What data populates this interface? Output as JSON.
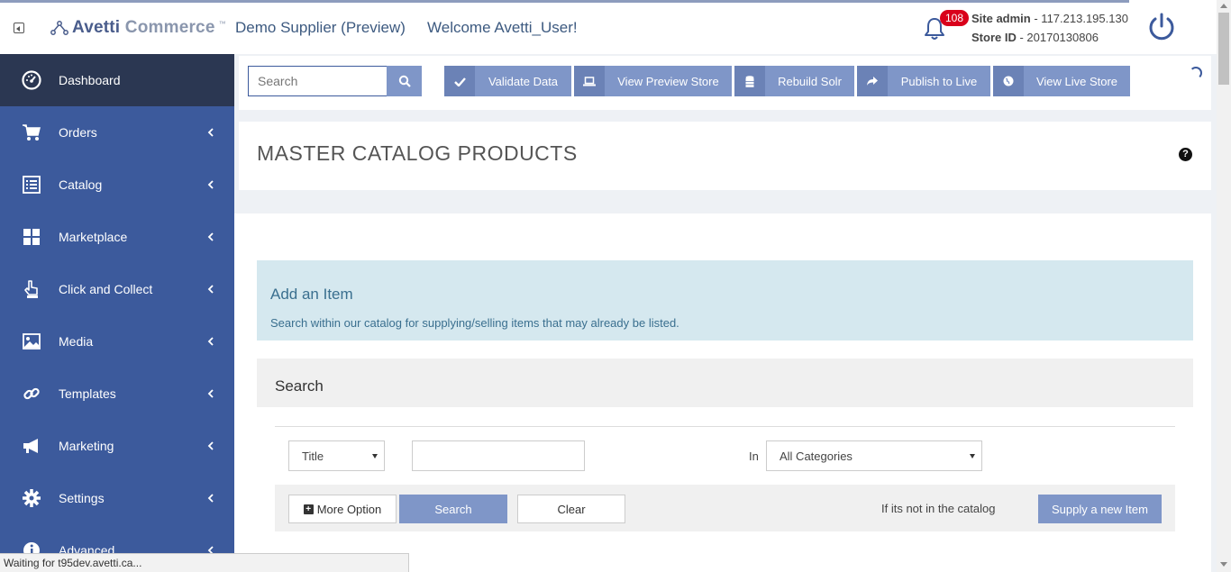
{
  "header": {
    "logo_brand": "Avetti",
    "logo_product": "Commerce",
    "logo_tm": "™",
    "store_name": "Demo Supplier (Preview)",
    "welcome": "Welcome Avetti_User!",
    "notification_count": "108",
    "site_admin_label": "Site admin",
    "site_admin_ip": " - 117.213.195.130",
    "store_id_label": "Store ID",
    "store_id_value": " - 20170130806"
  },
  "sidebar": {
    "items": [
      {
        "label": "Dashboard",
        "icon": "dashboard-gauge-icon"
      },
      {
        "label": "Orders",
        "icon": "shopping-cart-icon"
      },
      {
        "label": "Catalog",
        "icon": "list-icon"
      },
      {
        "label": "Marketplace",
        "icon": "grid-icon"
      },
      {
        "label": "Click and Collect",
        "icon": "hand-pointer-icon"
      },
      {
        "label": "Media",
        "icon": "image-icon"
      },
      {
        "label": "Templates",
        "icon": "link-icon"
      },
      {
        "label": "Marketing",
        "icon": "bullhorn-icon"
      },
      {
        "label": "Settings",
        "icon": "gear-icon"
      },
      {
        "label": "Advanced",
        "icon": "info-icon"
      }
    ]
  },
  "actionbar": {
    "search_placeholder": "Search",
    "buttons": [
      {
        "label": "Validate Data",
        "icon": "check-icon"
      },
      {
        "label": "View Preview Store",
        "icon": "laptop-icon"
      },
      {
        "label": "Rebuild Solr",
        "icon": "database-icon"
      },
      {
        "label": "Publish to Live",
        "icon": "share-arrow-icon"
      },
      {
        "label": "View Live Store",
        "icon": "globe-icon"
      }
    ]
  },
  "page": {
    "title": "MASTER CATALOG PRODUCTS",
    "help": "?"
  },
  "add_item": {
    "title": "Add an Item",
    "description": "Search within our catalog for supplying/selling items that may already be listed."
  },
  "search_form": {
    "panel_title": "Search",
    "field_select": "Title",
    "in_label": "In",
    "category_select": "All Categories",
    "more_option": "More Option",
    "search_button": "Search",
    "clear_button": "Clear",
    "not_in_catalog": "If its not in the catalog",
    "supply_new": "Supply a new Item"
  },
  "statusbar": {
    "text": "Waiting for t95dev.avetti.ca..."
  },
  "colors": {
    "sidebar_bg": "#3c5a9c",
    "sidebar_active": "#2b3752",
    "button_blue": "#7f96c8",
    "info_bg": "#d5e8ef",
    "badge_red": "#d9001b"
  }
}
